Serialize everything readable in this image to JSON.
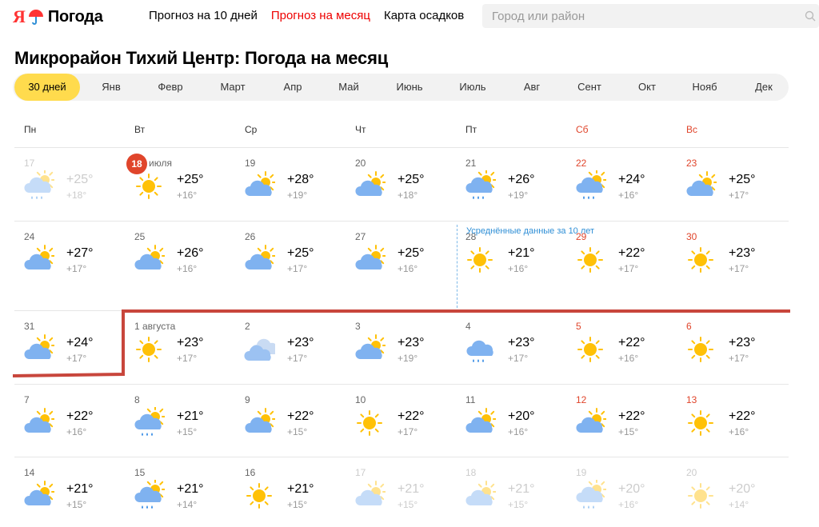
{
  "header": {
    "logo_ya": "Я",
    "logo_text": "Погода",
    "nav": [
      {
        "label": "Прогноз на 10 дней",
        "active": false
      },
      {
        "label": "Прогноз на месяц",
        "active": true
      },
      {
        "label": "Карта осадков",
        "active": false
      }
    ],
    "search_placeholder": "Город или район"
  },
  "page_title": "Микрорайон Тихий Центр: Погода на месяц",
  "months": [
    "30 дней",
    "Янв",
    "Февр",
    "Март",
    "Апр",
    "Май",
    "Июнь",
    "Июль",
    "Авг",
    "Сент",
    "Окт",
    "Нояб",
    "Дек"
  ],
  "active_month": "30 дней",
  "weekdays": [
    "Пн",
    "Вт",
    "Ср",
    "Чт",
    "Пт",
    "Сб",
    "Вс"
  ],
  "avg_note": "Усреднённые данные за 10 лет",
  "today_label": "18",
  "weeks": [
    [
      {
        "date": "17",
        "day": "+25°",
        "night": "+18°",
        "icon": "rain-cloud-sun",
        "past": true
      },
      {
        "date": "июля",
        "day": "+25°",
        "night": "+16°",
        "icon": "sun",
        "today": true
      },
      {
        "date": "19",
        "day": "+28°",
        "night": "+19°",
        "icon": "cloud-sun"
      },
      {
        "date": "20",
        "day": "+25°",
        "night": "+18°",
        "icon": "cloud-sun"
      },
      {
        "date": "21",
        "day": "+26°",
        "night": "+19°",
        "icon": "rain-cloud-sun"
      },
      {
        "date": "22",
        "day": "+24°",
        "night": "+16°",
        "icon": "rain-cloud-sun"
      },
      {
        "date": "23",
        "day": "+25°",
        "night": "+17°",
        "icon": "cloud-sun"
      }
    ],
    [
      {
        "date": "24",
        "day": "+27°",
        "night": "+17°",
        "icon": "cloud-sun"
      },
      {
        "date": "25",
        "day": "+26°",
        "night": "+16°",
        "icon": "cloud-sun"
      },
      {
        "date": "26",
        "day": "+25°",
        "night": "+17°",
        "icon": "cloud-sun"
      },
      {
        "date": "27",
        "day": "+25°",
        "night": "+16°",
        "icon": "cloud-sun"
      },
      {
        "date": "28",
        "day": "+21°",
        "night": "+16°",
        "icon": "sun"
      },
      {
        "date": "29",
        "day": "+22°",
        "night": "+17°",
        "icon": "sun"
      },
      {
        "date": "30",
        "day": "+23°",
        "night": "+17°",
        "icon": "sun"
      }
    ],
    [
      {
        "date": "31",
        "day": "+24°",
        "night": "+17°",
        "icon": "cloud-sun"
      },
      {
        "date": "1 августа",
        "day": "+23°",
        "night": "+17°",
        "icon": "sun"
      },
      {
        "date": "2",
        "day": "+23°",
        "night": "+17°",
        "icon": "cloudy"
      },
      {
        "date": "3",
        "day": "+23°",
        "night": "+19°",
        "icon": "cloud-sun"
      },
      {
        "date": "4",
        "day": "+23°",
        "night": "+17°",
        "icon": "rain-cloud"
      },
      {
        "date": "5",
        "day": "+22°",
        "night": "+16°",
        "icon": "sun"
      },
      {
        "date": "6",
        "day": "+23°",
        "night": "+17°",
        "icon": "sun"
      }
    ],
    [
      {
        "date": "7",
        "day": "+22°",
        "night": "+16°",
        "icon": "cloud-sun"
      },
      {
        "date": "8",
        "day": "+21°",
        "night": "+15°",
        "icon": "rain-cloud-sun"
      },
      {
        "date": "9",
        "day": "+22°",
        "night": "+15°",
        "icon": "cloud-sun"
      },
      {
        "date": "10",
        "day": "+22°",
        "night": "+17°",
        "icon": "sun"
      },
      {
        "date": "11",
        "day": "+20°",
        "night": "+16°",
        "icon": "cloud-sun"
      },
      {
        "date": "12",
        "day": "+22°",
        "night": "+15°",
        "icon": "cloud-sun"
      },
      {
        "date": "13",
        "day": "+22°",
        "night": "+16°",
        "icon": "sun"
      }
    ],
    [
      {
        "date": "14",
        "day": "+21°",
        "night": "+15°",
        "icon": "cloud-sun"
      },
      {
        "date": "15",
        "day": "+21°",
        "night": "+14°",
        "icon": "rain-cloud-sun"
      },
      {
        "date": "16",
        "day": "+21°",
        "night": "+15°",
        "icon": "sun"
      },
      {
        "date": "17",
        "day": "+21°",
        "night": "+15°",
        "icon": "cloud-sun",
        "past": true
      },
      {
        "date": "18",
        "day": "+21°",
        "night": "+15°",
        "icon": "cloud-sun",
        "past": true
      },
      {
        "date": "19",
        "day": "+20°",
        "night": "+16°",
        "icon": "rain-cloud-sun",
        "past": true
      },
      {
        "date": "20",
        "day": "+20°",
        "night": "+14°",
        "icon": "sun",
        "past": true
      }
    ]
  ],
  "colors": {
    "accent_red": "#e0452b",
    "nav_active": "#ee0000",
    "tab_active_bg": "#ffdb4d",
    "avg_blue": "#2f8fd6",
    "annotation_red": "#c8463c"
  }
}
